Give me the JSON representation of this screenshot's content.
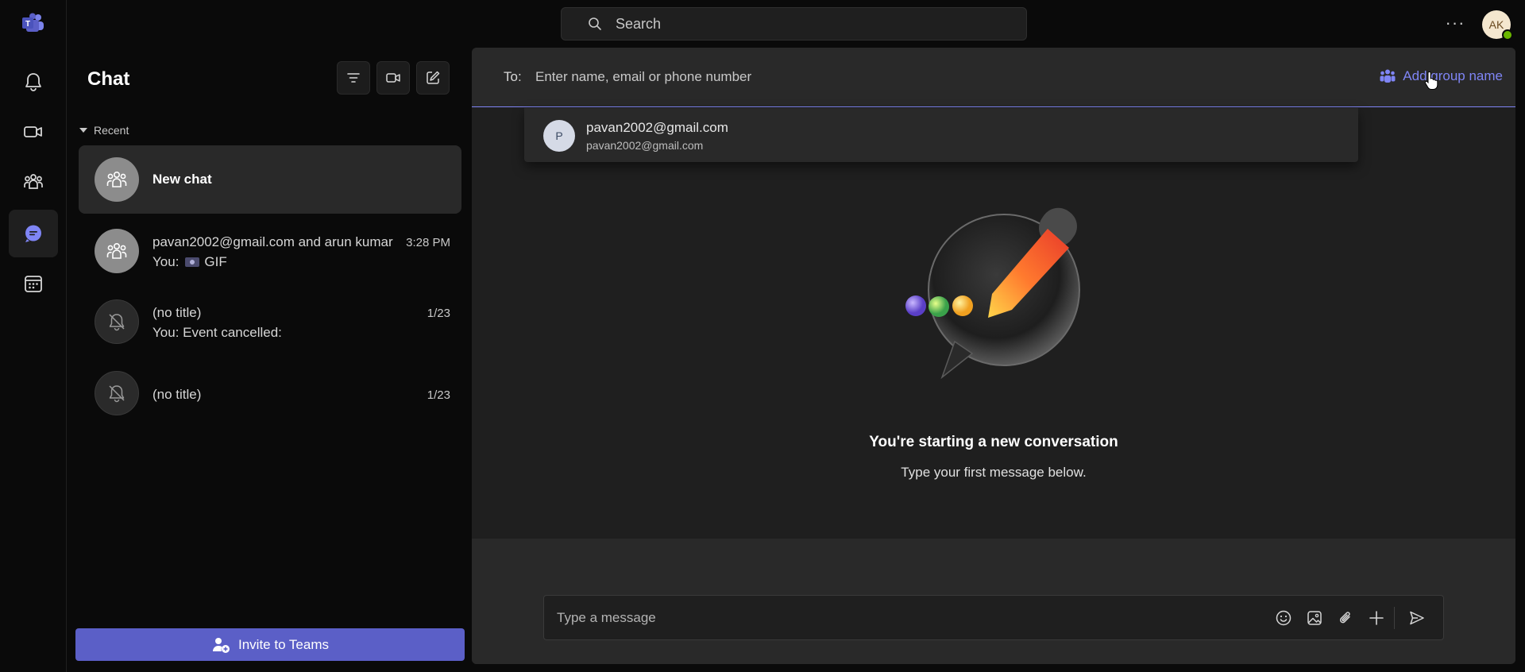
{
  "app": {
    "brand_color": "#5b5fc7",
    "accent_color": "#7f85f5",
    "logo_letter": "T"
  },
  "rail": {
    "items": [
      {
        "name": "activity",
        "icon": "bell-icon",
        "active": false
      },
      {
        "name": "meet",
        "icon": "video-camera-icon",
        "active": false
      },
      {
        "name": "communities",
        "icon": "people-group-icon",
        "active": false
      },
      {
        "name": "chat",
        "icon": "chat-bubble-icon",
        "active": true
      },
      {
        "name": "calendar",
        "icon": "calendar-icon",
        "active": false
      }
    ]
  },
  "topbar": {
    "search_placeholder": "Search",
    "more_label": "···",
    "user_initials": "AK"
  },
  "sidebar": {
    "title": "Chat",
    "tools": [
      "filter-icon",
      "meet-now-icon",
      "new-chat-icon"
    ],
    "section_label": "Recent",
    "chats": [
      {
        "title": "New chat",
        "subtitle": "",
        "time": "",
        "avatar": "group",
        "selected": true
      },
      {
        "title": "pavan2002@gmail.com and arun kumar",
        "subtitle_prefix": "You:",
        "subtitle": "GIF",
        "time": "3:28 PM",
        "avatar": "group",
        "selected": false
      },
      {
        "title": "(no title)",
        "subtitle": "You: Event cancelled:",
        "time": "1/23",
        "avatar": "muted",
        "selected": false
      },
      {
        "title": "(no title)",
        "subtitle": "",
        "time": "1/23",
        "avatar": "muted",
        "selected": false
      }
    ],
    "invite_label": "Invite to Teams"
  },
  "main": {
    "to_label": "To:",
    "to_placeholder": "Enter name, email or phone number",
    "add_group_label": "Add group name",
    "suggestion": {
      "initial": "P",
      "name": "pavan2002@gmail.com",
      "email": "pavan2002@gmail.com"
    },
    "empty_title": "You're starting a new conversation",
    "empty_subtitle": "Type your first message below.",
    "compose_placeholder": "Type a message",
    "compose_actions": [
      "emoji-icon",
      "image-icon",
      "attach-icon",
      "plus-icon",
      "send-icon"
    ]
  }
}
